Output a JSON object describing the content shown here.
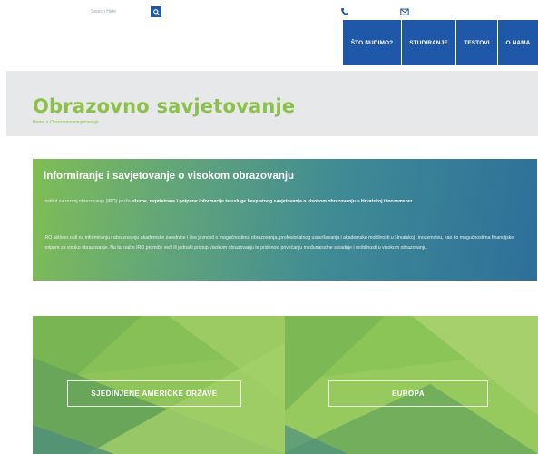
{
  "topbar": {
    "search_placeholder": "Search Here",
    "icons": [
      "search-icon",
      "phone-icon",
      "email-icon"
    ]
  },
  "nav": {
    "items": [
      {
        "label": "ŠTO NUDIMO?"
      },
      {
        "label": "STUDIRANJE"
      },
      {
        "label": "TESTOVI"
      },
      {
        "label": "O NAMA"
      }
    ]
  },
  "page": {
    "title": "Obrazovno savjetovanje",
    "breadcrumb": "Home > Obrazovno savjetovanje"
  },
  "info": {
    "title": "Informiranje i savjetovanje o visokom obrazovanju",
    "p1_lead": "Institut za razvoj obrazovanja (IRO) pruža ",
    "p1_bold": "ažurne, nepristrane i potpune informacije te usluge besplatnog savjetovanja o visokom obrazovanju u Hrvatskoj i inozemstvu.",
    "p2": "IRO aktivno radi na informiranju i obrazovanju akademske zajednice i šire javnosti o mogućnostima obrazovanja, profesionalnog usavršavanja i akademske mobilnosti u Hrvatskoj i inozemstvu, kao i o mogućnostima financijske potpore za visoko obrazovanje. Na taj način IRO promiče veći ili jednaki pristup visokom obrazovanju te pridonosi povećanju međunarodne suradnje i mobilnosti u visokom obrazovanju."
  },
  "tiles": [
    {
      "label": "SJEDINJENE AMERIČKE DRŽAVE"
    },
    {
      "label": "EUROPA"
    }
  ],
  "colors": {
    "brand_blue": "#1f58a8",
    "brand_green": "#8cc04a",
    "header_band": "#e7e8e9",
    "card_gradient_start": "#80bd55",
    "card_gradient_end": "#2e6f9a"
  }
}
